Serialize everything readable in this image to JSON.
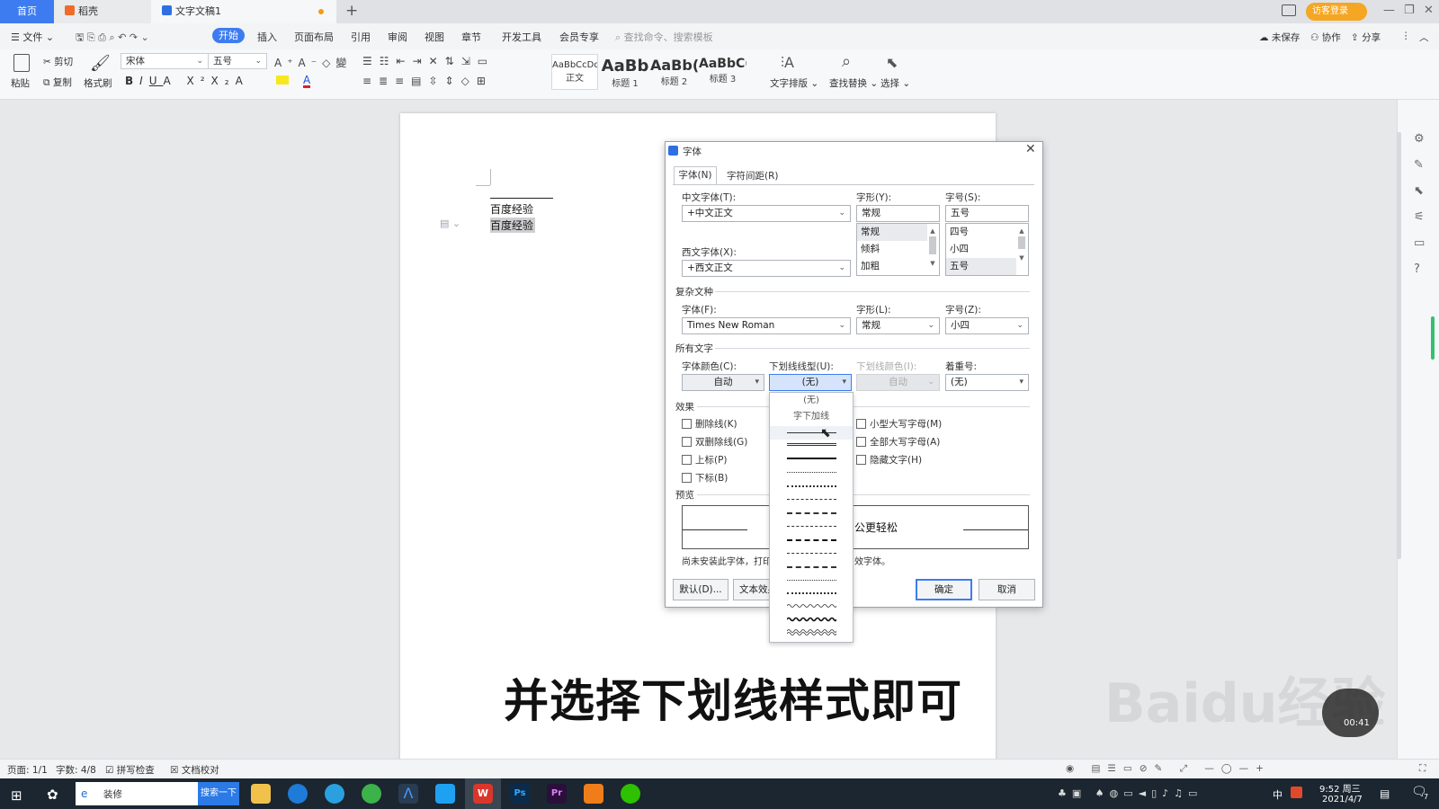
{
  "tabs": {
    "home": "首页",
    "daoke": "稻壳",
    "doc": "文字文稿1",
    "add": "+"
  },
  "titlebar": {
    "login": "访客登录"
  },
  "menu": {
    "file": "文件",
    "items": [
      "开始",
      "插入",
      "页面布局",
      "引用",
      "审阅",
      "视图",
      "章节",
      "开发工具",
      "会员专享"
    ],
    "search_placeholder": "查找命令、搜索模板",
    "unsaved": "未保存",
    "collab": "协作",
    "share": "分享"
  },
  "ribbon": {
    "paste": "粘贴",
    "cut": "剪切",
    "copy": "复制",
    "format_painter": "格式刷",
    "font_name": "宋体",
    "font_size": "五号",
    "styles": [
      {
        "preview": "AaBbCcDd",
        "label": "正文"
      },
      {
        "preview": "AaBb",
        "label": "标题 1"
      },
      {
        "preview": "AaBb(",
        "label": "标题 2"
      },
      {
        "preview": "AaBbC(",
        "label": "标题 3"
      }
    ],
    "text_layout": "文字排版",
    "find_replace": "查找替换",
    "select": "选择"
  },
  "document": {
    "line1": "百度经验",
    "line2": "百度经验"
  },
  "dialog": {
    "title": "字体",
    "tab_font": "字体(N)",
    "tab_spacing": "字符间距(R)",
    "cn_font_label": "中文字体(T):",
    "cn_font_value": "+中文正文",
    "style_label": "字形(Y):",
    "style_value": "常规",
    "style_options": [
      "常规",
      "倾斜",
      "加粗"
    ],
    "size_label": "字号(S):",
    "size_value": "五号",
    "size_options": [
      "四号",
      "小四",
      "五号"
    ],
    "west_font_label": "西文字体(X):",
    "west_font_value": "+西文正文",
    "complex_section": "复杂文种",
    "complex_font_label": "字体(F):",
    "complex_font_value": "Times New Roman",
    "complex_style_label": "字形(L):",
    "complex_style_value": "常规",
    "complex_size_label": "字号(Z):",
    "complex_size_value": "小四",
    "all_text_section": "所有文字",
    "color_label": "字体颜色(C):",
    "color_value": "自动",
    "underline_label": "下划线线型(U):",
    "underline_value": "(无)",
    "underline_color_label": "下划线颜色(I):",
    "underline_color_value": "自动",
    "emphasis_label": "着重号:",
    "emphasis_value": "(无)",
    "effects_section": "效果",
    "effects_left": [
      "删除线(K)",
      "双删除线(G)",
      "上标(P)",
      "下标(B)"
    ],
    "effects_right": [
      "小型大写字母(M)",
      "全部大写字母(A)",
      "隐藏文字(H)"
    ],
    "preview_section": "预览",
    "preview_text": "公更轻松",
    "note_prefix": "尚未安装此字体，打印",
    "note_suffix": "效字体。",
    "default_btn": "默认(D)...",
    "text_effects_btn": "文本效果",
    "ok_btn": "确定",
    "cancel_btn": "取消"
  },
  "underline_dropdown": {
    "none": "(无)",
    "words_only": "字下加线"
  },
  "status": {
    "page": "页面: 1/1",
    "words": "字数: 4/8",
    "spell": "拼写检查",
    "proof": "文档校对"
  },
  "taskbar": {
    "search_text": "装修",
    "search_btn": "搜索一下",
    "time": "9:52 周三",
    "date": "2021/4/7",
    "ime": "中",
    "notif": "7"
  },
  "overlay": {
    "caption": "并选择下划线样式即可",
    "watermark": "Baidu经验",
    "video_time": "00:41"
  }
}
